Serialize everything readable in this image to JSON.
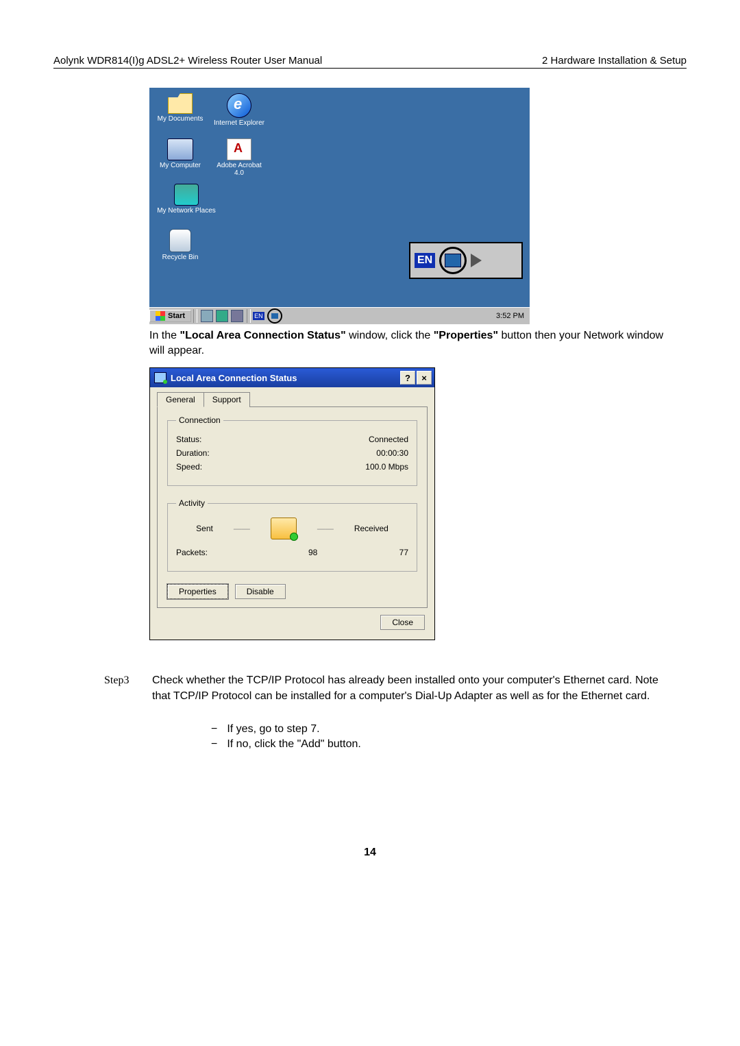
{
  "header": {
    "left": "Aolynk WDR814(I)g ADSL2+ Wireless Router User Manual",
    "right": "2 Hardware Installation & Setup"
  },
  "desktop": {
    "icons": {
      "my_documents": "My Documents",
      "internet_explorer": "Internet Explorer",
      "my_computer": "My Computer",
      "adobe_acrobat": "Adobe Acrobat 4.0",
      "my_network_places": "My Network Places",
      "recycle_bin": "Recycle Bin"
    },
    "taskbar": {
      "start": "Start",
      "lang": "EN",
      "clock": "3:52 PM"
    },
    "tray_zoom_lang": "EN"
  },
  "instruction1_pre": "In the ",
  "instruction1_bold1": "\"Local Area Connection Status\"",
  "instruction1_mid": " window, click the ",
  "instruction1_bold2": "\"Properties\"",
  "instruction1_post": " button then your Network window will appear.",
  "dialog": {
    "title": "Local Area Connection Status",
    "help_btn": "?",
    "close_btn": "×",
    "tabs": {
      "general": "General",
      "support": "Support"
    },
    "connection": {
      "legend": "Connection",
      "status_label": "Status:",
      "status_value": "Connected",
      "duration_label": "Duration:",
      "duration_value": "00:00:30",
      "speed_label": "Speed:",
      "speed_value": "100.0 Mbps"
    },
    "activity": {
      "legend": "Activity",
      "sent_label": "Sent",
      "received_label": "Received",
      "packets_label": "Packets:",
      "sent_value": "98",
      "received_value": "77"
    },
    "buttons": {
      "properties": "Properties",
      "disable": "Disable",
      "close": "Close"
    }
  },
  "step3": {
    "label": "Step3",
    "text": "Check whether the TCP/IP Protocol has already been installed onto your computer's Ethernet card. Note that TCP/IP Protocol can be installed for a computer's Dial-Up Adapter as well as for the Ethernet card.",
    "sub1": "If yes, go to step 7.",
    "sub2": "If no, click the \"Add\" button."
  },
  "page_number": "14"
}
